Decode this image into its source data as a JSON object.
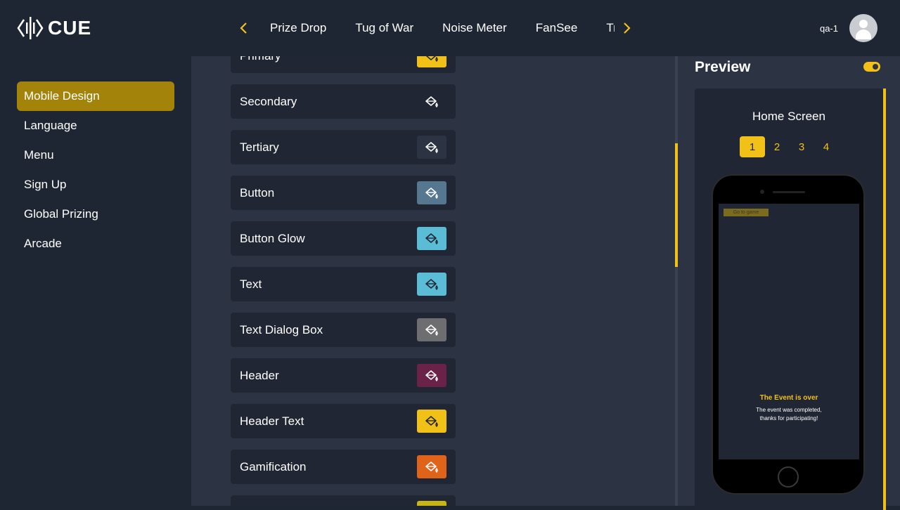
{
  "header": {
    "logo_text": "CUE",
    "prev_icon": "chevron-left-icon",
    "next_icon": "chevron-right-icon",
    "tabs": [
      "Prize Drop",
      "Tug of War",
      "Noise Meter",
      "FanSee",
      "Trivia"
    ],
    "username": "qa-1"
  },
  "sidebar": {
    "items": [
      {
        "label": "Mobile Design",
        "active": true
      },
      {
        "label": "Language"
      },
      {
        "label": "Menu"
      },
      {
        "label": "Sign Up"
      },
      {
        "label": "Global Prizing"
      },
      {
        "label": "Arcade"
      }
    ]
  },
  "colors": {
    "rows": [
      {
        "label": "Primary",
        "color": "#f2c118",
        "icon": "paint-bucket-icon"
      },
      {
        "label": "Secondary",
        "color": "#202633",
        "icon": "paint-bucket-icon"
      },
      {
        "label": "Tertiary",
        "color": "#2c3444",
        "icon": "paint-bucket-icon"
      },
      {
        "label": "Button",
        "color": "#55778f",
        "icon": "paint-bucket-icon"
      },
      {
        "label": "Button Glow",
        "color": "#5bbcd6",
        "icon": "paint-bucket-icon"
      },
      {
        "label": "Text",
        "color": "#5bbcd6",
        "icon": "paint-bucket-icon"
      },
      {
        "label": "Text Dialog Box",
        "color": "#6e6e70",
        "icon": "paint-bucket-icon"
      },
      {
        "label": "Header",
        "color": "#6b2248",
        "icon": "paint-bucket-icon"
      },
      {
        "label": "Header Text",
        "color": "#f2c118",
        "icon": "paint-bucket-icon"
      },
      {
        "label": "Gamification",
        "color": "#e0631a",
        "icon": "paint-bucket-icon"
      },
      {
        "label": "",
        "color": "#c9b612",
        "icon": "paint-bucket-icon"
      }
    ]
  },
  "preview": {
    "title": "Preview",
    "toggle_on": true,
    "screen_name": "Home Screen",
    "pages": [
      "1",
      "2",
      "3",
      "4"
    ],
    "active_page": "1",
    "phone": {
      "button_label": "Go to game",
      "event_title": "The Event is over",
      "event_text_line1": "The event was completed,",
      "event_text_line2": "thanks for participating!"
    }
  },
  "accent": "#f2c118"
}
